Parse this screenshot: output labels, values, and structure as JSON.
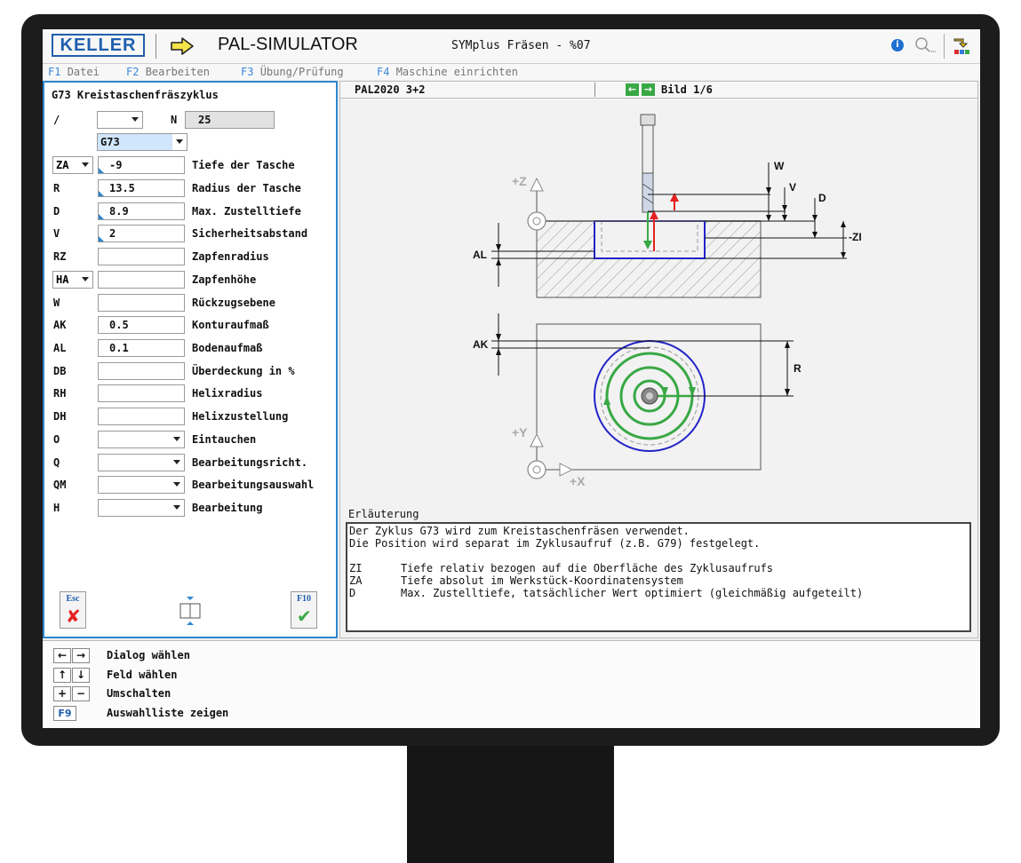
{
  "app": {
    "logo": "KELLER",
    "title": "PAL-SIMULATOR",
    "subtitle": "SYMplus Fräsen - %07"
  },
  "menu": [
    {
      "key": "F1",
      "label": "Datei"
    },
    {
      "key": "F2",
      "label": "Bearbeiten"
    },
    {
      "key": "F3",
      "label": "Übung/Prüfung"
    },
    {
      "key": "F4",
      "label": "Maschine einrichten"
    }
  ],
  "form": {
    "title": "G73 Kreistaschenfräszyklus",
    "slash": "/",
    "n_label": "N",
    "n_value": "25",
    "g_code": "G73",
    "fields": [
      {
        "label": "ZA",
        "value": "-9",
        "desc": "Tiefe der Tasche"
      },
      {
        "label": "R",
        "value": "13.5",
        "desc": "Radius der Tasche"
      },
      {
        "label": "D",
        "value": "8.9",
        "desc": "Max. Zustelltiefe"
      },
      {
        "label": "V",
        "value": "2",
        "desc": "Sicherheitsabstand"
      },
      {
        "label": "RZ",
        "value": "",
        "desc": "Zapfenradius"
      },
      {
        "label": "HA",
        "value": "",
        "desc": "Zapfenhöhe"
      },
      {
        "label": "W",
        "value": "",
        "desc": "Rückzugsebene"
      },
      {
        "label": "AK",
        "value": "0.5",
        "desc": "Konturaufmaß"
      },
      {
        "label": "AL",
        "value": "0.1",
        "desc": "Bodenaufmaß"
      },
      {
        "label": "DB",
        "value": "",
        "desc": "Überdeckung in %"
      },
      {
        "label": "RH",
        "value": "",
        "desc": "Helixradius"
      },
      {
        "label": "DH",
        "value": "",
        "desc": "Helixzustellung"
      },
      {
        "label": "O",
        "value": "",
        "desc": "Eintauchen"
      },
      {
        "label": "Q",
        "value": "",
        "desc": "Bearbeitungsricht."
      },
      {
        "label": "QM",
        "value": "",
        "desc": "Bearbeitungsauswahl"
      },
      {
        "label": "H",
        "value": "",
        "desc": "Bearbeitung"
      }
    ],
    "esc_key": "Esc",
    "f10_key": "F10"
  },
  "preview": {
    "title": "PAL2020 3+2",
    "page": "Bild 1/6",
    "labels": {
      "w": "W",
      "v": "V",
      "d": "D",
      "zi": "-ZI",
      "al": "AL",
      "ak": "AK",
      "r": "R",
      "pz": "+Z",
      "py": "+Y",
      "px": "+X"
    }
  },
  "explanation": {
    "title": "Erläuterung",
    "line1": "Der Zyklus G73 wird zum Kreistaschenfräsen verwendet.",
    "line2": "Die Position wird separat im Zyklusaufruf (z.B. G79) festgelegt.",
    "terms": [
      {
        "code": "ZI",
        "text": "Tiefe relativ bezogen auf die Oberfläche des Zyklusaufrufs"
      },
      {
        "code": "ZA",
        "text": "Tiefe absolut im Werkstück-Koordinatensystem"
      },
      {
        "code": "D",
        "text": "Max. Zustelltiefe, tatsächlicher Wert optimiert (gleichmäßig aufgeteilt)"
      }
    ]
  },
  "footer": [
    {
      "keys": [
        "←",
        "→"
      ],
      "text": "Dialog wählen"
    },
    {
      "keys": [
        "↑",
        "↓"
      ],
      "text": "Feld wählen"
    },
    {
      "keys": [
        "+",
        "−"
      ],
      "text": "Umschalten"
    },
    {
      "keys": [
        "F9"
      ],
      "text": "Auswahlliste zeigen"
    }
  ],
  "colors": {
    "accent": "#2e86d0",
    "green": "#39a845",
    "red": "#e52222",
    "pocket_blue": "#2323c8"
  }
}
